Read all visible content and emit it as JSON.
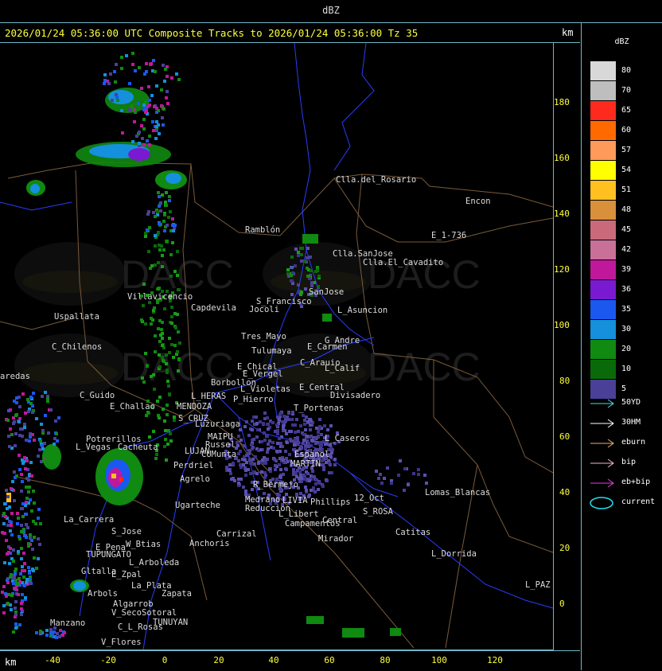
{
  "window": {
    "title": "dBZ"
  },
  "header": {
    "product_text": "2026/01/24 05:36:00 UTC Composite Tracks to 2026/01/24 05:36:00 Tz 35",
    "units_top": "km",
    "units_bottom": "km"
  },
  "axes": {
    "y_ticks": [
      "180",
      "160",
      "140",
      "120",
      "100",
      "80",
      "60",
      "40",
      "20",
      "0"
    ],
    "x_ticks": [
      "-40",
      "-20",
      "0",
      "20",
      "40",
      "60",
      "80",
      "100",
      "120"
    ]
  },
  "legend": {
    "title": "dBZ",
    "levels": [
      {
        "label": "80",
        "color": "#d8d8d8"
      },
      {
        "label": "70",
        "color": "#bebebe"
      },
      {
        "label": "65",
        "color": "#ff2a1e"
      },
      {
        "label": "60",
        "color": "#ff6a00"
      },
      {
        "label": "57",
        "color": "#ff9a5a"
      },
      {
        "label": "54",
        "color": "#ffff00"
      },
      {
        "label": "51",
        "color": "#ffc020"
      },
      {
        "label": "48",
        "color": "#d8903a"
      },
      {
        "label": "45",
        "color": "#c86a7a"
      },
      {
        "label": "42",
        "color": "#c87098"
      },
      {
        "label": "39",
        "color": "#c0189a"
      },
      {
        "label": "36",
        "color": "#7a1ad0"
      },
      {
        "label": "35",
        "color": "#1a58f0"
      },
      {
        "label": "30",
        "color": "#1490dc"
      },
      {
        "label": "20",
        "color": "#108a10"
      },
      {
        "label": "10",
        "color": "#0a6a0a"
      },
      {
        "label": "5",
        "color": "#4a4098"
      }
    ],
    "tracks": [
      {
        "label": "50YD",
        "color": "#4fd8e0"
      },
      {
        "label": "30HM",
        "color": "#ffffff"
      },
      {
        "label": "eburn",
        "color": "#e8b070"
      },
      {
        "label": "bip",
        "color": "#f0b8c0"
      },
      {
        "label": "eb+bip",
        "color": "#e040e0"
      },
      {
        "label": "current",
        "color": "#20e0f0"
      }
    ]
  },
  "watermark": {
    "brand": "DACC"
  },
  "places": [
    {
      "name": "Clla.del_Rosario"
    },
    {
      "name": "Encon"
    },
    {
      "name": "E_1-736"
    },
    {
      "name": "Ramblón"
    },
    {
      "name": "Clla.SanJose"
    },
    {
      "name": "Clla.El_Cavadito"
    },
    {
      "name": "Villavicencio"
    },
    {
      "name": "Uspallata"
    },
    {
      "name": "Capdevila"
    },
    {
      "name": "S_Francisco"
    },
    {
      "name": "Jocoli"
    },
    {
      "name": "SanJose"
    },
    {
      "name": "L_Asuncion"
    },
    {
      "name": "C_Chilenos"
    },
    {
      "name": "Tres_Mayo"
    },
    {
      "name": "Tulumaya"
    },
    {
      "name": "G_Andre"
    },
    {
      "name": "E_Carmen"
    },
    {
      "name": "E_Chical"
    },
    {
      "name": "E_Vergel"
    },
    {
      "name": "C_Arauio"
    },
    {
      "name": "L_Calif"
    },
    {
      "name": "Borbollon"
    },
    {
      "name": "L_Violetas"
    },
    {
      "name": "E_Central"
    },
    {
      "name": "Divisadero"
    },
    {
      "name": "L_HERAS"
    },
    {
      "name": "P_Hierro"
    },
    {
      "name": "C_Guido"
    },
    {
      "name": "E_Challao"
    },
    {
      "name": "MENDOZA"
    },
    {
      "name": "T_Portenas"
    },
    {
      "name": "S_CRUZ"
    },
    {
      "name": "Luzuriaga"
    },
    {
      "name": "Potrerillos"
    },
    {
      "name": "MAIPU"
    },
    {
      "name": "L_Vegas"
    },
    {
      "name": "Cacheuta"
    },
    {
      "name": "Russel"
    },
    {
      "name": "LUJAN"
    },
    {
      "name": "CUMunta"
    },
    {
      "name": "L_Caseros"
    },
    {
      "name": "Perdriel"
    },
    {
      "name": "MARTIN"
    },
    {
      "name": "Agrelo"
    },
    {
      "name": "Espanol"
    },
    {
      "name": "R_Bermejo"
    },
    {
      "name": "Ugarteche"
    },
    {
      "name": "Medrano"
    },
    {
      "name": "Reduccion"
    },
    {
      "name": "LIVIA"
    },
    {
      "name": "Phillips"
    },
    {
      "name": "12_Oct"
    },
    {
      "name": "Lomas_Blancas"
    },
    {
      "name": "S_ROSA"
    },
    {
      "name": "La_Carrera"
    },
    {
      "name": "L_Libert"
    },
    {
      "name": "Campamentos"
    },
    {
      "name": "Central"
    },
    {
      "name": "S_Jose"
    },
    {
      "name": "Carrizal"
    },
    {
      "name": "Catitas"
    },
    {
      "name": "E_Pena"
    },
    {
      "name": "TUPUNGATO"
    },
    {
      "name": "W_Btias"
    },
    {
      "name": "Anchoris"
    },
    {
      "name": "Mirador"
    },
    {
      "name": "L_Arboleda"
    },
    {
      "name": "L_Dorrida"
    },
    {
      "name": "Gltalla"
    },
    {
      "name": "E_Zpal"
    },
    {
      "name": "La_Plata"
    },
    {
      "name": "Arbols"
    },
    {
      "name": "Zapata"
    },
    {
      "name": "Algarrob"
    },
    {
      "name": "V_Seco"
    },
    {
      "name": "Sotoral"
    },
    {
      "name": "TUNUYAN"
    },
    {
      "name": "Manzano"
    },
    {
      "name": "C_L_Rosas"
    },
    {
      "name": "V_Flores"
    },
    {
      "name": "L_PAZ"
    },
    {
      "name": "aredas"
    }
  ]
}
